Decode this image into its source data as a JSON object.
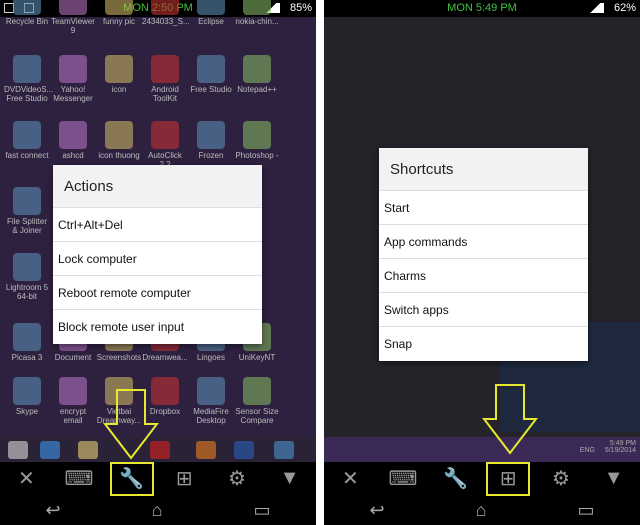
{
  "left": {
    "status": {
      "time": "MON 2:50 PM",
      "battery": "85%"
    },
    "desktop_icons": [
      "Recycle Bin",
      "TeamViewer 9",
      "funny pic",
      "2434033_S...",
      "Eclipse",
      "nokia-chin...",
      "DVDVideoS... Free Studio",
      "Yahoo! Messenger",
      "icon",
      "Android ToolKit",
      "Free Studio",
      "Notepad++",
      "fast connect",
      "ashcd",
      "icon thuong",
      "AutoClick 2.2",
      "Frozen",
      "Photoshop - ...",
      "File Splitter & Joiner",
      "Lightroom 5 64-bit",
      "Picasa 3",
      "Document",
      "Screenshots",
      "Dreamwea...",
      "Lingoes",
      "UniKeyNT",
      "Skype",
      "encrypt email",
      "Vietbai Dreamway...",
      "Dropbox",
      "MediaFire Desktop",
      "Sensor Size Compare"
    ],
    "dialog": {
      "title": "Actions",
      "items": [
        "Ctrl+Alt+Del",
        "Lock computer",
        "Reboot remote computer",
        "Block remote user input"
      ]
    }
  },
  "right": {
    "status": {
      "time": "MON 5:49 PM",
      "battery": "62%"
    },
    "dialog": {
      "title": "Shortcuts",
      "items": [
        "Start",
        "App commands",
        "Charms",
        "Switch apps",
        "Snap"
      ]
    },
    "tray": {
      "lang": "ENG",
      "time": "5:49 PM",
      "date": "5/19/2014"
    }
  },
  "toolbar_icons": [
    "close-icon",
    "keyboard-icon",
    "wrench-icon",
    "windows-icon",
    "gear-icon",
    "dropdown-icon"
  ],
  "colors": {
    "highlight": "#e8e830",
    "clock": "#3ec43e",
    "desktop": "#2e2140"
  }
}
